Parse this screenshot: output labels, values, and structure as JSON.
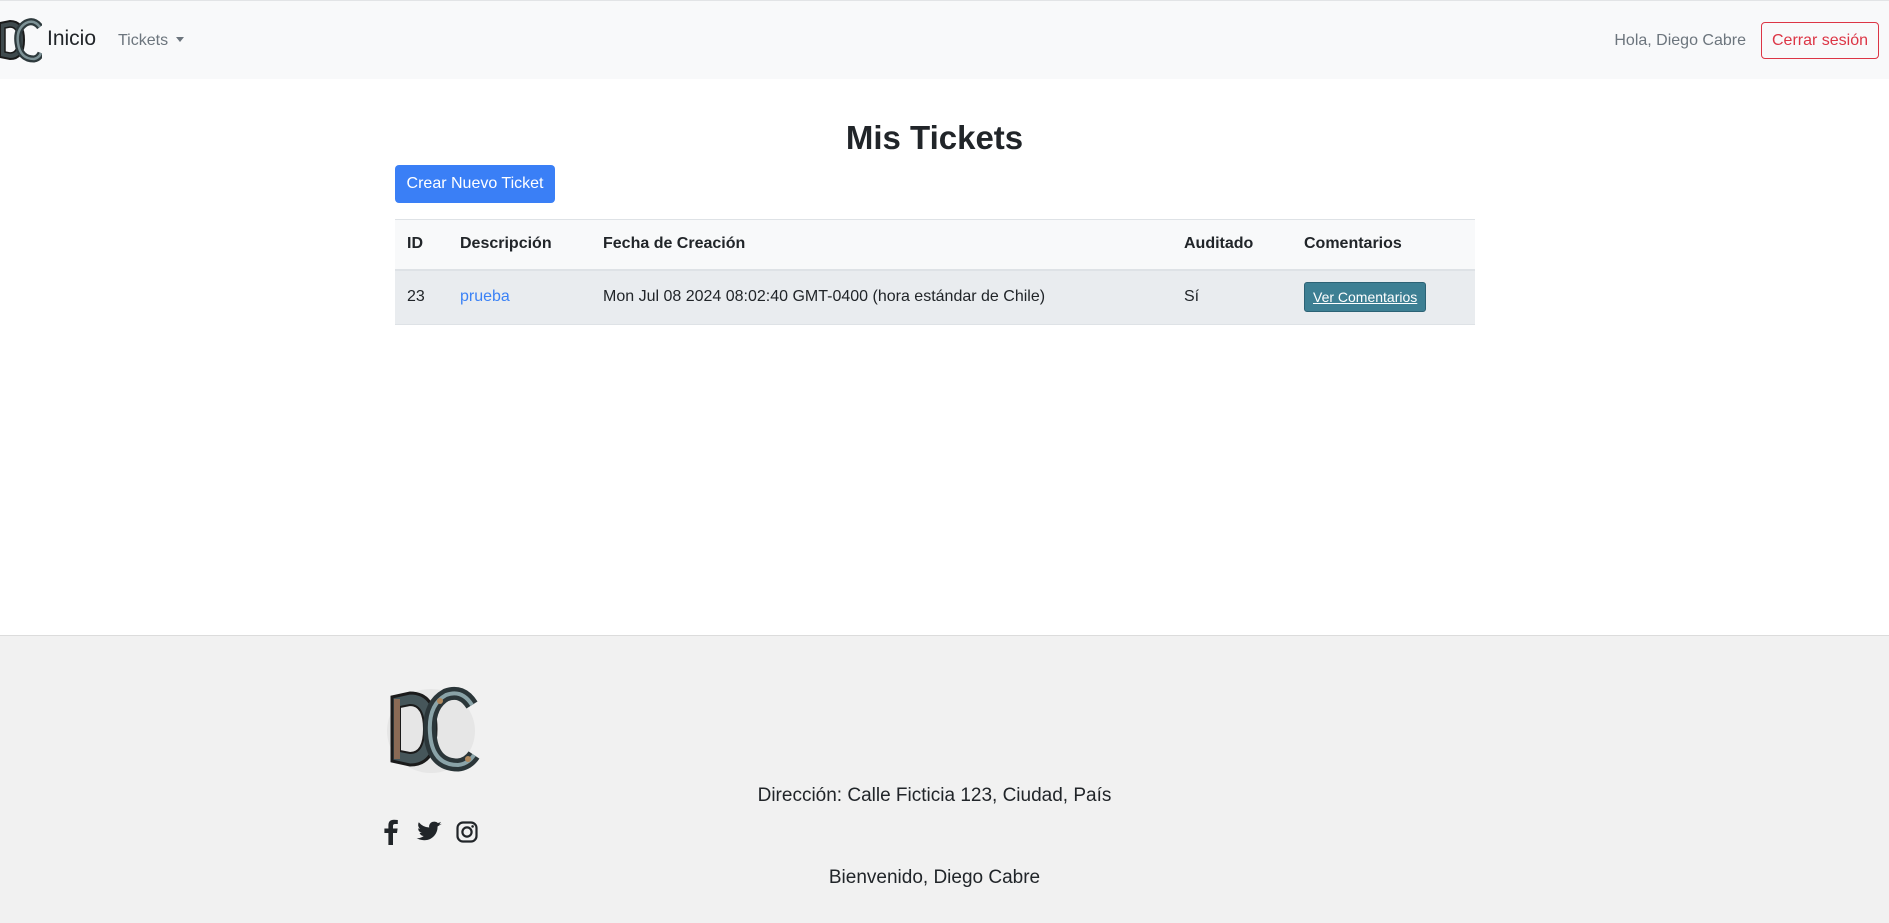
{
  "navbar": {
    "brand": "Inicio",
    "tickets_menu": "Tickets",
    "greeting": "Hola, Diego Cabre",
    "logout": "Cerrar sesión"
  },
  "main": {
    "title": "Mis Tickets",
    "create_button": "Crear Nuevo Ticket",
    "table": {
      "headers": [
        "ID",
        "Descripción",
        "Fecha de Creación",
        "Auditado",
        "Comentarios"
      ],
      "rows": [
        {
          "id": "23",
          "descripcion": "prueba",
          "fecha": "Mon Jul 08 2024 08:02:40 GMT-0400 (hora estándar de Chile)",
          "auditado": "Sí",
          "comentarios": "Ver Comentarios"
        }
      ]
    }
  },
  "footer": {
    "address": "Dirección: Calle Ficticia 123, Ciudad, País",
    "welcome": "Bienvenido, Diego Cabre",
    "social_icons": [
      "facebook-icon",
      "twitter-icon",
      "instagram-icon"
    ]
  },
  "colors": {
    "primary": "#3a7ff6",
    "danger": "#dc3545",
    "info_button": "#3d7f93",
    "navbar_bg": "#f8f9fa",
    "footer_bg": "#f1f1f1"
  }
}
